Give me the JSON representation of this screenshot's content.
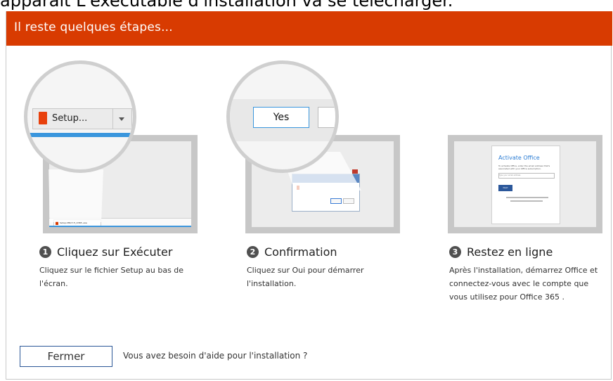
{
  "page": {
    "caption": "apparaît L'exécutable d'installation va se télécharger."
  },
  "dialog": {
    "title": "Il reste quelques étapes...",
    "accent_color": "#d83b01",
    "close_label": "Fermer",
    "help_text": "Vous avez besoin d'aide pour l'installation ?"
  },
  "steps": [
    {
      "number": "1",
      "title": "Cliquez sur Exécuter",
      "description": "Cliquez sur le fichier Setup au bas de l'écran.",
      "setup_button_label": "Setup...",
      "taskbar_item_label": "Setup.X86.fr-fr_O365..exe"
    },
    {
      "number": "2",
      "title": "Confirmation",
      "description": "Cliquez sur Oui pour démarrer l'installation.",
      "yes_button_label": "Yes"
    },
    {
      "number": "3",
      "title": "Restez en ligne",
      "description": "Après l'installation, démarrez Office et connectez-vous avec le compte que vous utilisez pour Office 365 .",
      "activate_title": "Activate Office",
      "activate_text": "To activate Office, enter the email address that's associated with your Office subscription.",
      "activate_input_placeholder": "Type your email address",
      "activate_button_label": "Next"
    }
  ]
}
